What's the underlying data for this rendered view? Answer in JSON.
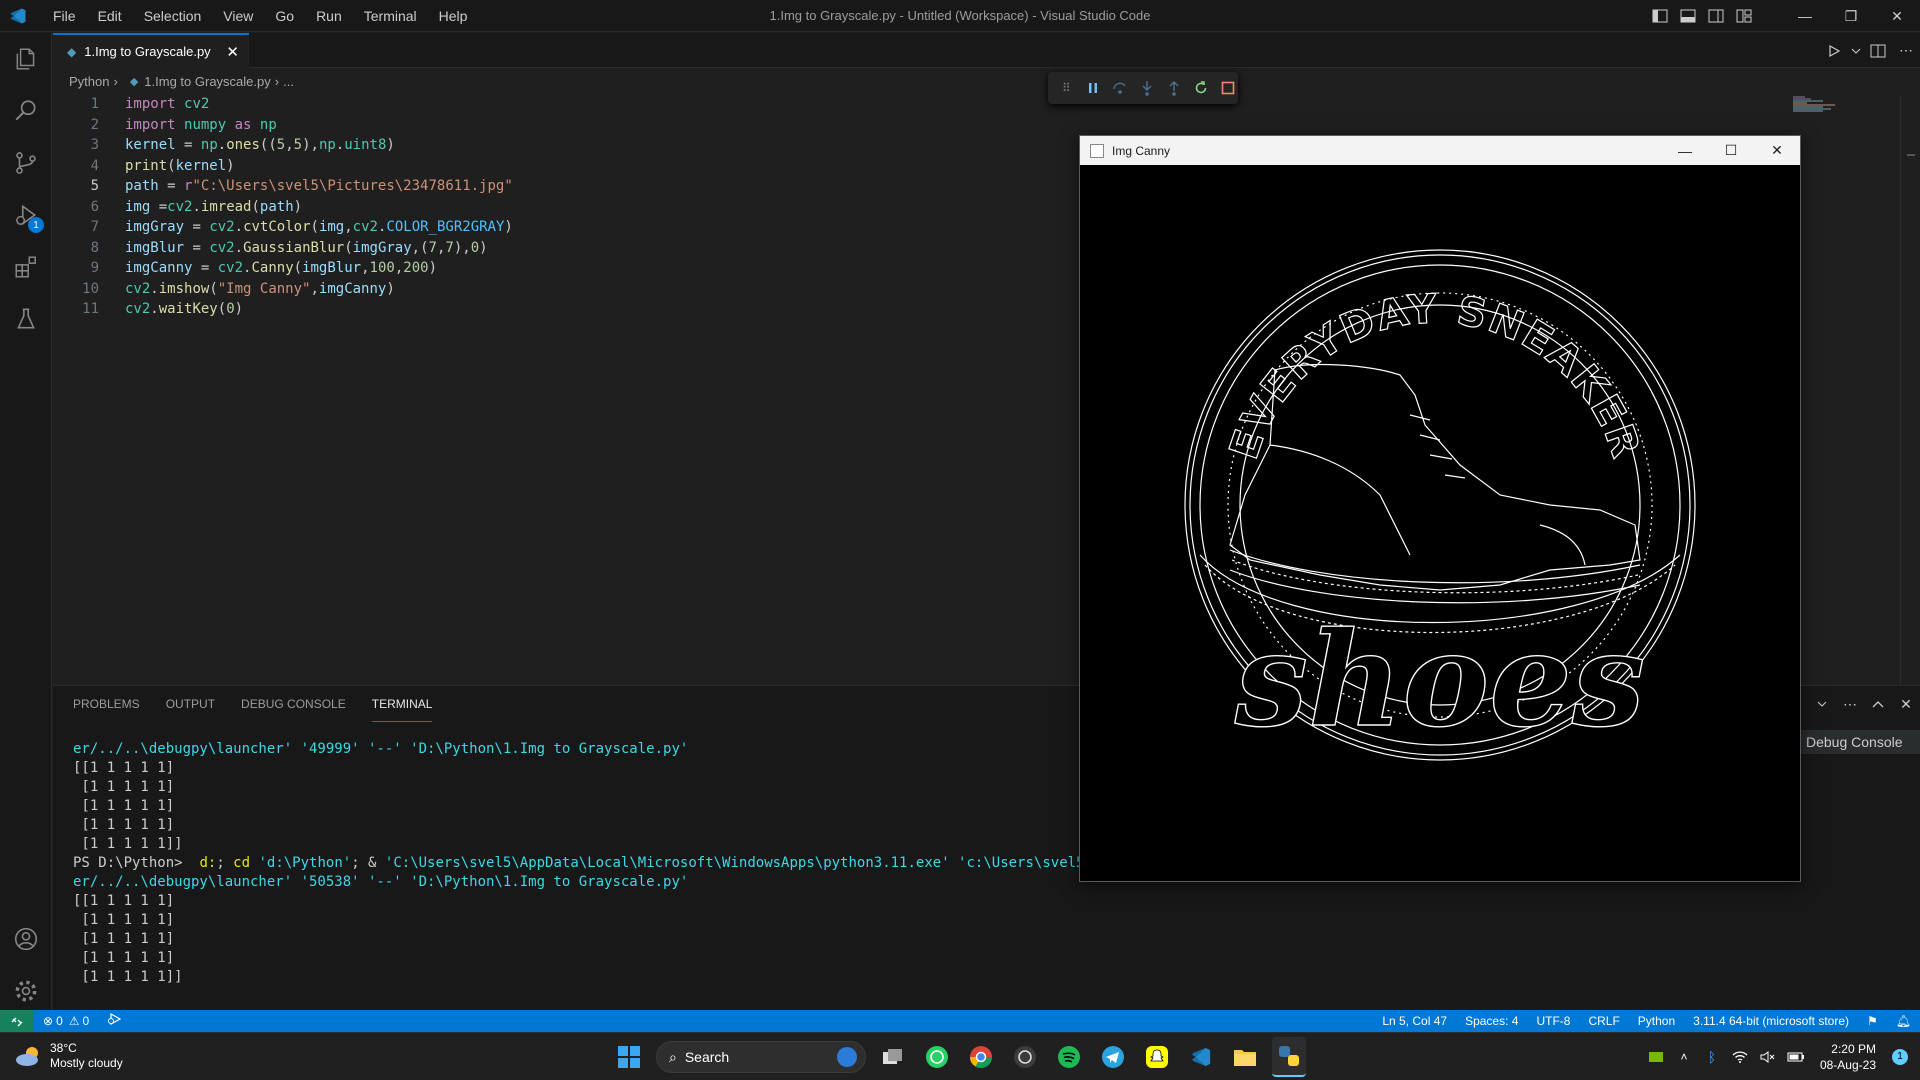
{
  "titlebar": {
    "menu": [
      "File",
      "Edit",
      "Selection",
      "View",
      "Go",
      "Run",
      "Terminal",
      "Help"
    ],
    "title": "1.Img to Grayscale.py - Untitled (Workspace) - Visual Studio Code"
  },
  "activitybar": {
    "items": [
      "explorer-icon",
      "search-icon",
      "source-control-icon",
      "run-debug-icon",
      "extensions-icon",
      "testing-icon"
    ],
    "debug_badge": "1"
  },
  "tabs": [
    {
      "label": "1.Img to Grayscale.py",
      "close": "✕"
    }
  ],
  "breadcrumb": [
    "Python",
    "›",
    "1.Img to Grayscale.py",
    "›",
    "..."
  ],
  "editor": {
    "line_numbers": [
      "1",
      "2",
      "3",
      "4",
      "5",
      "6",
      "7",
      "8",
      "9",
      "10",
      "11"
    ],
    "current_line": 5
  },
  "panel": {
    "tabs": [
      "PROBLEMS",
      "OUTPUT",
      "DEBUG CONSOLE",
      "TERMINAL"
    ],
    "active_tab": "TERMINAL",
    "side_label": "Debug Console"
  },
  "terminal": {
    "line1": "er/../..\\debugpy\\launcher' '49999' '--' 'D:\\Python\\1.Img to Grayscale.py'",
    "matrix1": [
      "[[1 1 1 1 1]",
      " [1 1 1 1 1]",
      " [1 1 1 1 1]",
      " [1 1 1 1 1]",
      " [1 1 1 1 1]]"
    ],
    "prompt": "PS D:\\Python> ",
    "cmd_a": " d:",
    "cmd_b": "; ",
    "cmd_c": "cd",
    "cmd_d": " 'd:\\Python'",
    "cmd_e": "; & ",
    "cmd_f": "'C:\\Users\\svel5\\AppData\\Local\\Microsoft\\WindowsApps\\python3.11.exe' 'c:\\Users\\svel5\\.vsco",
    "line2": "er/../..\\debugpy\\launcher' '50538' '--' 'D:\\Python\\1.Img to Grayscale.py'",
    "matrix2": [
      "[[1 1 1 1 1]",
      " [1 1 1 1 1]",
      " [1 1 1 1 1]",
      " [1 1 1 1 1]",
      " [1 1 1 1 1]]"
    ]
  },
  "cv_window": {
    "title": "Img Canny",
    "logo_top_text": "EVERYDAY SNEAKER",
    "logo_word": "shoes"
  },
  "statusbar": {
    "errors": "0",
    "warnings": "0",
    "position": "Ln 5, Col 47",
    "spaces": "Spaces: 4",
    "encoding": "UTF-8",
    "eol": "CRLF",
    "language": "Python",
    "interpreter": "3.11.4 64-bit (microsoft store)"
  },
  "taskbar": {
    "temperature": "38°C",
    "weather": "Mostly cloudy",
    "search": "Search",
    "time": "2:20 PM",
    "date": "08-Aug-23",
    "notif": "1"
  },
  "colors": {
    "accent": "#0078d4",
    "statusbar": "#0078d4",
    "remote": "#16825d"
  }
}
